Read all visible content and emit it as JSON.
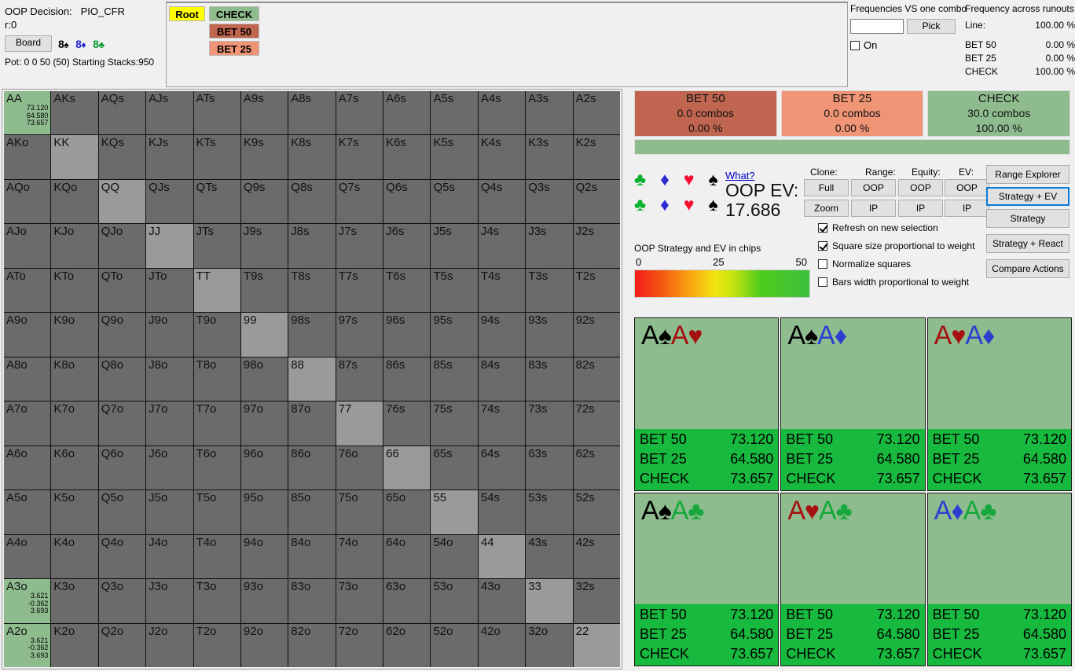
{
  "header": {
    "decision_label": "OOP Decision:",
    "decision_value": "PIO_CFR",
    "node_id": "r:0",
    "board_button": "Board",
    "board_cards": [
      {
        "rank": "8",
        "suit": "♠",
        "color": "s"
      },
      {
        "rank": "8",
        "suit": "♦",
        "color": "d"
      },
      {
        "rank": "8",
        "suit": "♣",
        "color": "c"
      }
    ],
    "pot_line": "Pot: 0 0 50 (50) Starting Stacks:950"
  },
  "tree": {
    "root": "Root",
    "check": "CHECK",
    "bet50": "BET 50",
    "bet25": "BET 25"
  },
  "frequencies": {
    "vs_combo_title": "Frequencies VS one combo",
    "input_value": "",
    "pick_button": "Pick",
    "on_label": "On",
    "on_checked": false,
    "runouts_title": "Frequency across runouts:",
    "line_label": "Line:",
    "line_value": "100.00 %",
    "rows": [
      {
        "label": "BET 50",
        "value": "0.00 %"
      },
      {
        "label": "BET 25",
        "value": "0.00 %"
      },
      {
        "label": "CHECK",
        "value": "100.00 %"
      }
    ]
  },
  "matrix": {
    "rows": [
      [
        "AA",
        "AKs",
        "AQs",
        "AJs",
        "ATs",
        "A9s",
        "A8s",
        "A7s",
        "A6s",
        "A5s",
        "A4s",
        "A3s",
        "A2s"
      ],
      [
        "AKo",
        "KK",
        "KQs",
        "KJs",
        "KTs",
        "K9s",
        "K8s",
        "K7s",
        "K6s",
        "K5s",
        "K4s",
        "K3s",
        "K2s"
      ],
      [
        "AQo",
        "KQo",
        "QQ",
        "QJs",
        "QTs",
        "Q9s",
        "Q8s",
        "Q7s",
        "Q6s",
        "Q5s",
        "Q4s",
        "Q3s",
        "Q2s"
      ],
      [
        "AJo",
        "KJo",
        "QJo",
        "JJ",
        "JTs",
        "J9s",
        "J8s",
        "J7s",
        "J6s",
        "J5s",
        "J4s",
        "J3s",
        "J2s"
      ],
      [
        "ATo",
        "KTo",
        "QTo",
        "JTo",
        "TT",
        "T9s",
        "T8s",
        "T7s",
        "T6s",
        "T5s",
        "T4s",
        "T3s",
        "T2s"
      ],
      [
        "A9o",
        "K9o",
        "Q9o",
        "J9o",
        "T9o",
        "99",
        "98s",
        "97s",
        "96s",
        "95s",
        "94s",
        "93s",
        "92s"
      ],
      [
        "A8o",
        "K8o",
        "Q8o",
        "J8o",
        "T8o",
        "98o",
        "88",
        "87s",
        "86s",
        "85s",
        "84s",
        "83s",
        "82s"
      ],
      [
        "A7o",
        "K7o",
        "Q7o",
        "J7o",
        "T7o",
        "97o",
        "87o",
        "77",
        "76s",
        "75s",
        "74s",
        "73s",
        "72s"
      ],
      [
        "A6o",
        "K6o",
        "Q6o",
        "J6o",
        "T6o",
        "96o",
        "86o",
        "76o",
        "66",
        "65s",
        "64s",
        "63s",
        "62s"
      ],
      [
        "A5o",
        "K5o",
        "Q5o",
        "J5o",
        "T5o",
        "95o",
        "85o",
        "75o",
        "65o",
        "55",
        "54s",
        "53s",
        "52s"
      ],
      [
        "A4o",
        "K4o",
        "Q4o",
        "J4o",
        "T4o",
        "94o",
        "84o",
        "74o",
        "64o",
        "54o",
        "44",
        "43s",
        "42s"
      ],
      [
        "A3o",
        "K3o",
        "Q3o",
        "J3o",
        "T3o",
        "93o",
        "83o",
        "73o",
        "63o",
        "53o",
        "43o",
        "33",
        "32s"
      ],
      [
        "A2o",
        "K2o",
        "Q2o",
        "J2o",
        "T2o",
        "92o",
        "82o",
        "72o",
        "62o",
        "52o",
        "42o",
        "32o",
        "22"
      ]
    ],
    "selected": {
      "AA": [
        "73.120",
        "64.580",
        "73.657"
      ],
      "A3o": [
        "3.621",
        "-0.362",
        "3.693"
      ],
      "A2o": [
        "3.621",
        "-0.362",
        "3.693"
      ]
    }
  },
  "actions": [
    {
      "name": "BET 50",
      "combos": "0.0 combos",
      "pct": "0.00 %",
      "color": "#c0654f"
    },
    {
      "name": "BET 25",
      "combos": "0.0 combos",
      "pct": "0.00 %",
      "color": "#ef9475"
    },
    {
      "name": "CHECK",
      "combos": "30.0 combos",
      "pct": "100.00 %",
      "color": "#8fbc8f"
    }
  ],
  "controls": {
    "what_link": "What?",
    "oop_ev_label": "OOP EV:",
    "oop_ev_value": "17.686",
    "strategy_caption": "OOP Strategy and EV in chips",
    "scale": {
      "min": "0",
      "mid": "25",
      "max": "50"
    },
    "column_headers": [
      "Clone:",
      "Range:",
      "Equity:",
      "EV:"
    ],
    "buttons_row1": [
      "Full",
      "OOP",
      "OOP",
      "OOP"
    ],
    "buttons_row2": [
      "Zoom",
      "IP",
      "IP",
      "IP"
    ],
    "options": [
      {
        "label": "Refresh on new selection",
        "checked": true
      },
      {
        "label": "Square size proportional to weight",
        "checked": true
      },
      {
        "label": "Normalize squares",
        "checked": false
      },
      {
        "label": "Bars width proportional to weight",
        "checked": false
      }
    ],
    "side_buttons": [
      {
        "label": "Range Explorer",
        "active": false
      },
      {
        "label": "Strategy + EV",
        "active": true
      },
      {
        "label": "Strategy",
        "active": false
      },
      {
        "label": "Strategy + React",
        "active": false
      },
      {
        "label": "Compare Actions",
        "active": false
      }
    ]
  },
  "combos": [
    {
      "cards": [
        {
          "rank": "A",
          "suit": "♠",
          "color": "s"
        },
        {
          "rank": "A",
          "suit": "♥",
          "color": "h"
        }
      ],
      "rows": [
        {
          "label": "BET 50",
          "value": "73.120"
        },
        {
          "label": "BET 25",
          "value": "64.580"
        },
        {
          "label": "CHECK",
          "value": "73.657"
        }
      ]
    },
    {
      "cards": [
        {
          "rank": "A",
          "suit": "♠",
          "color": "s"
        },
        {
          "rank": "A",
          "suit": "♦",
          "color": "d"
        }
      ],
      "rows": [
        {
          "label": "BET 50",
          "value": "73.120"
        },
        {
          "label": "BET 25",
          "value": "64.580"
        },
        {
          "label": "CHECK",
          "value": "73.657"
        }
      ]
    },
    {
      "cards": [
        {
          "rank": "A",
          "suit": "♥",
          "color": "h"
        },
        {
          "rank": "A",
          "suit": "♦",
          "color": "d"
        }
      ],
      "rows": [
        {
          "label": "BET 50",
          "value": "73.120"
        },
        {
          "label": "BET 25",
          "value": "64.580"
        },
        {
          "label": "CHECK",
          "value": "73.657"
        }
      ]
    },
    {
      "cards": [
        {
          "rank": "A",
          "suit": "♠",
          "color": "s"
        },
        {
          "rank": "A",
          "suit": "♣",
          "color": "c"
        }
      ],
      "rows": [
        {
          "label": "BET 50",
          "value": "73.120"
        },
        {
          "label": "BET 25",
          "value": "64.580"
        },
        {
          "label": "CHECK",
          "value": "73.657"
        }
      ]
    },
    {
      "cards": [
        {
          "rank": "A",
          "suit": "♥",
          "color": "h"
        },
        {
          "rank": "A",
          "suit": "♣",
          "color": "c"
        }
      ],
      "rows": [
        {
          "label": "BET 50",
          "value": "73.120"
        },
        {
          "label": "BET 25",
          "value": "64.580"
        },
        {
          "label": "CHECK",
          "value": "73.657"
        }
      ]
    },
    {
      "cards": [
        {
          "rank": "A",
          "suit": "♦",
          "color": "d"
        },
        {
          "rank": "A",
          "suit": "♣",
          "color": "c"
        }
      ],
      "rows": [
        {
          "label": "BET 50",
          "value": "73.120"
        },
        {
          "label": "BET 25",
          "value": "64.580"
        },
        {
          "label": "CHECK",
          "value": "73.657"
        }
      ]
    }
  ],
  "suit_selectors": {
    "row1": [
      {
        "glyph": "♣",
        "color": "c"
      },
      {
        "glyph": "♦",
        "color": "d"
      },
      {
        "glyph": "♥",
        "color": "h"
      },
      {
        "glyph": "♠",
        "color": "s"
      }
    ],
    "row2": [
      {
        "glyph": "♣",
        "color": "c"
      },
      {
        "glyph": "♦",
        "color": "d"
      },
      {
        "glyph": "♥",
        "color": "h"
      },
      {
        "glyph": "♠",
        "color": "s"
      }
    ]
  }
}
